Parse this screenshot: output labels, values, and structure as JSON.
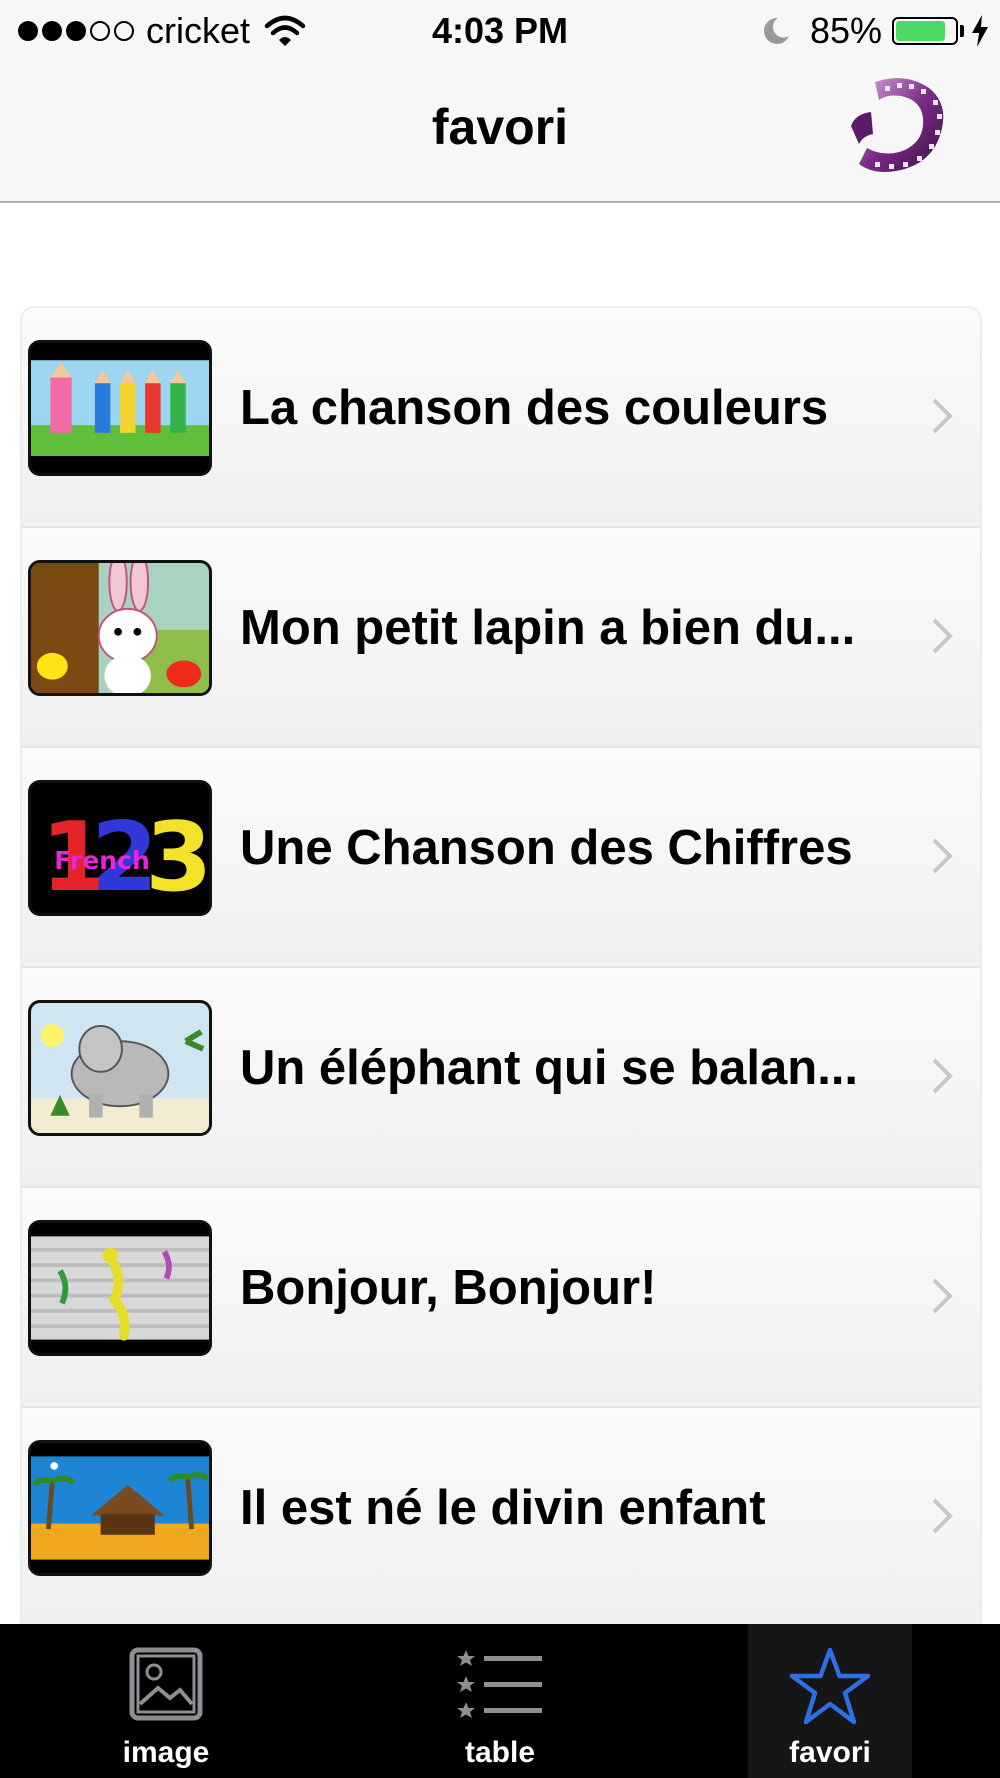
{
  "status": {
    "carrier": "cricket",
    "time": "4:03 PM",
    "battery": "85%",
    "battery_level": 0.85,
    "signal_bars": 3,
    "signal_total": 5
  },
  "nav": {
    "title": "favori",
    "right_icon": "film-reel-icon"
  },
  "favorites": [
    {
      "title": "La chanson des couleurs",
      "thumbnail": "colored-pencils-thumbnail"
    },
    {
      "title": "Mon petit lapin a bien du...",
      "thumbnail": "rabbit-thumbnail"
    },
    {
      "title": "Une Chanson des Chiffres",
      "thumbnail": "numbers-123-thumbnail",
      "thumb_text": "French"
    },
    {
      "title": "Un éléphant qui se balan...",
      "thumbnail": "elephant-thumbnail"
    },
    {
      "title": "Bonjour, Bonjour!",
      "thumbnail": "dancing-figures-thumbnail"
    },
    {
      "title": "Il est né le divin enfant",
      "thumbnail": "nativity-thumbnail"
    }
  ],
  "tabs": [
    {
      "label": "image",
      "icon": "image-icon",
      "active": false
    },
    {
      "label": "table",
      "icon": "list-icon",
      "active": false
    },
    {
      "label": "favori",
      "icon": "star-icon",
      "active": true
    }
  ],
  "colors": {
    "tab_active": "#2f6fe6",
    "battery_fill": "#4cd964",
    "tab_bar": "#000000"
  }
}
